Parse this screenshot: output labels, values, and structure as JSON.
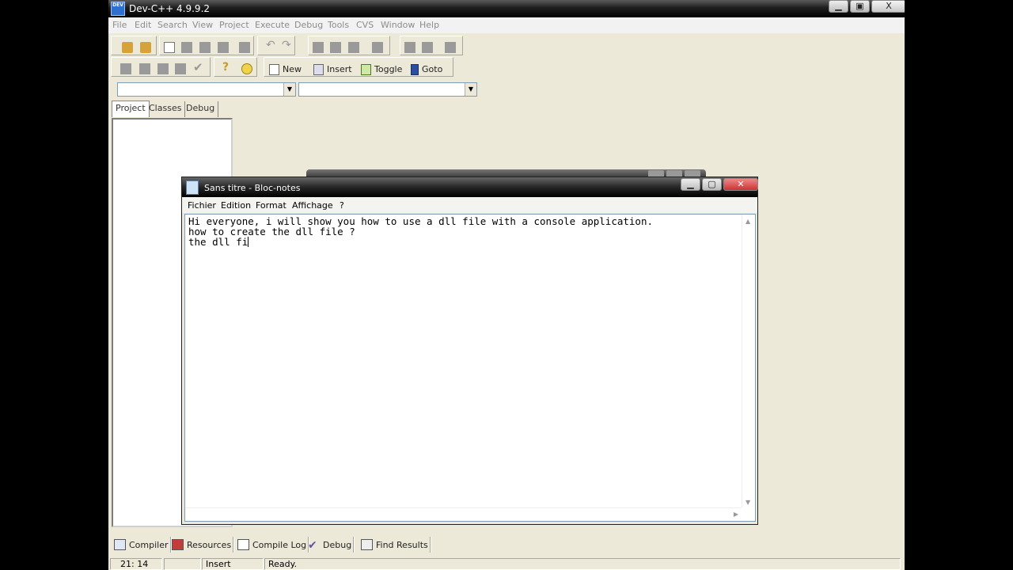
{
  "devcpp": {
    "title": "Dev-C++ 4.9.9.2",
    "logo_text": "DEV",
    "window_buttons": {
      "minimize": "▁",
      "restore": "▣",
      "close": "X"
    },
    "menu": [
      "File",
      "Edit",
      "Search",
      "View",
      "Project",
      "Execute",
      "Debug",
      "Tools",
      "CVS",
      "Window",
      "Help"
    ],
    "toolbar": {
      "new_label": "New",
      "insert_label": "Insert",
      "toggle_label": "Toggle",
      "goto_label": "Goto"
    },
    "tabs": [
      "Project",
      "Classes",
      "Debug"
    ],
    "bottom_tabs": [
      "Compiler",
      "Resources",
      "Compile Log",
      "Debug",
      "Find Results"
    ],
    "status": {
      "position": "21: 14",
      "blank": "",
      "mode": "Insert",
      "message": "Ready."
    }
  },
  "notepad": {
    "title": "Sans titre - Bloc-notes",
    "window_buttons": {
      "minimize": "▁",
      "maximize": "▢",
      "close": "✕"
    },
    "menu": [
      "Fichier",
      "Edition",
      "Format",
      "Affichage",
      "?"
    ],
    "lines": [
      "Hi everyone, i will show you how to use a dll file with a console application.",
      "how to create the dll file ?",
      "the dll fi"
    ]
  }
}
